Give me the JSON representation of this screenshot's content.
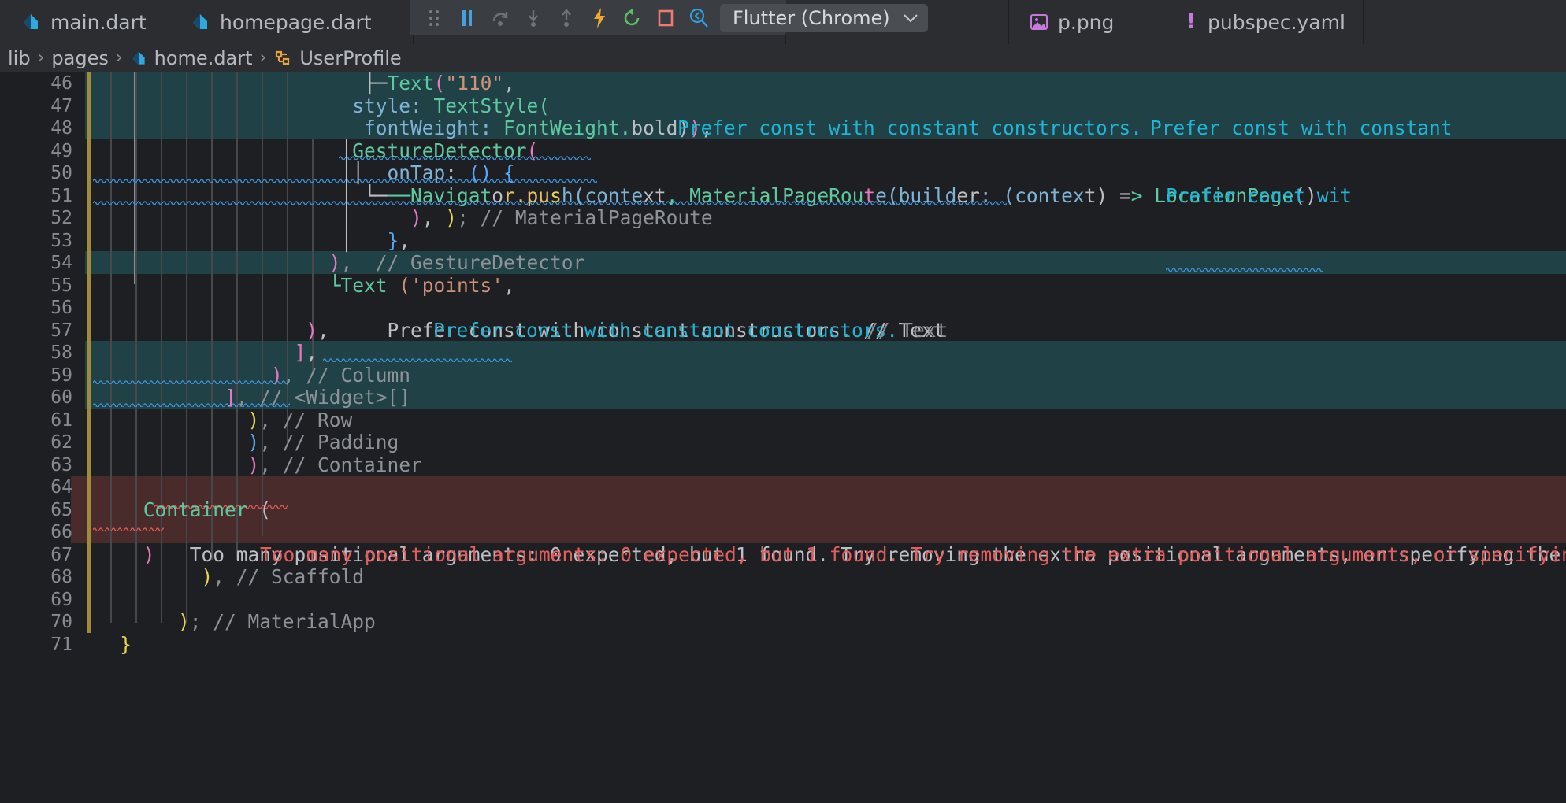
{
  "window": {
    "theme": "dark",
    "accent": "#3a8fd6",
    "background": "#1e1f22",
    "chrome_background": "#2b2d30"
  },
  "tabs": [
    {
      "label": "main.dart",
      "icon": "dart-file-icon",
      "active": false
    },
    {
      "label": "homepage.dart",
      "icon": "dart-file-icon",
      "active": false
    },
    {
      "label": "p.png",
      "icon": "image-file-icon",
      "active": false
    },
    {
      "label": "pubspec.yaml",
      "icon": "yaml-file-icon",
      "active": false
    }
  ],
  "debug_toolbar": {
    "drag_handle": "drag-handle-icon",
    "buttons": [
      {
        "name": "pause-button",
        "icon": "pause-icon",
        "color": "#4a9eda",
        "tooltip": "Pause Program"
      },
      {
        "name": "step-over-button",
        "icon": "step-over-icon",
        "color": "#6e7378",
        "tooltip": "Step Over"
      },
      {
        "name": "step-into-button",
        "icon": "step-into-icon",
        "color": "#6e7378",
        "tooltip": "Step Into"
      },
      {
        "name": "step-out-button",
        "icon": "step-out-icon",
        "color": "#6e7378",
        "tooltip": "Step Out"
      },
      {
        "name": "hot-reload-button",
        "icon": "lightning-icon",
        "color": "#f0a82e",
        "tooltip": "Hot Reload"
      },
      {
        "name": "hot-restart-button",
        "icon": "restart-icon",
        "color": "#5bbd6a",
        "tooltip": "Hot Restart"
      },
      {
        "name": "stop-button",
        "icon": "stop-square-icon",
        "color": "#f07a72",
        "tooltip": "Stop"
      },
      {
        "name": "widget-inspector-button",
        "icon": "magnifier-icon",
        "color": "#2f9fe0",
        "tooltip": "Open Flutter Inspector"
      }
    ],
    "device_selector": {
      "value": "Flutter (Chrome)",
      "chevron": "chevron-down-icon"
    }
  },
  "breadcrumb": {
    "separator": "›",
    "segments": [
      {
        "label": "lib",
        "icon": null
      },
      {
        "label": "pages",
        "icon": null
      },
      {
        "label": "home.dart",
        "icon": "dart-file-icon"
      },
      {
        "label": "UserProfile",
        "icon": "flutter-widget-icon"
      }
    ]
  },
  "editor": {
    "first_line": 46,
    "last_line": 71,
    "line_numbers": [
      46,
      47,
      48,
      49,
      50,
      51,
      52,
      53,
      54,
      55,
      56,
      57,
      58,
      59,
      60,
      61,
      62,
      63,
      64,
      65,
      66,
      67,
      68,
      69,
      70,
      71
    ],
    "lines": [
      {
        "n": 46,
        "text": "                        ├─Text(\"110\","
      },
      {
        "n": 47,
        "text": "                       style: TextStyle("
      },
      {
        "n": 48,
        "text": "                        fontWeight: FontWeight.bold)),"
      },
      {
        "n": 49,
        "text": "                      │GestureDetector("
      },
      {
        "n": 50,
        "text": "                      ││  onTap: () {"
      },
      {
        "n": 51,
        "text": "                      │ └───Navigator.push(context, MaterialPageRoute(builder: (context) => LocationPage()"
      },
      {
        "n": 52,
        "text": "                      │     ), ); // MaterialPageRoute"
      },
      {
        "n": 53,
        "text": "                      │   },"
      },
      {
        "n": 54,
        "text": "                     ),  // GestureDetector"
      },
      {
        "n": 55,
        "text": "                     └Text ('points',"
      },
      {
        "n": 56,
        "text": ""
      },
      {
        "n": 57,
        "text": "                   ),     Prefer const with constant constructors. // Text"
      },
      {
        "n": 58,
        "text": "                  ],"
      },
      {
        "n": 59,
        "text": "                ), // Column"
      },
      {
        "n": 60,
        "text": "            ], // <Widget>[]"
      },
      {
        "n": 61,
        "text": "              ), // Row"
      },
      {
        "n": 62,
        "text": "              ), // Padding"
      },
      {
        "n": 63,
        "text": "              ), // Container"
      },
      {
        "n": 64,
        "text": ""
      },
      {
        "n": 65,
        "text": "     Container ("
      },
      {
        "n": 66,
        "text": ""
      },
      {
        "n": 67,
        "text": "     )   Too many positional arguments: 0 expected, but 1 found. Try removing the extra positional arguments, or specifying the"
      },
      {
        "n": 68,
        "text": "          ), // Scaffold"
      },
      {
        "n": 69,
        "text": ""
      },
      {
        "n": 70,
        "text": "        ); // MaterialApp"
      },
      {
        "n": 71,
        "text": "   }"
      }
    ],
    "inline_hints": [
      {
        "line": 48,
        "text": "Prefer const with constant constructors.",
        "color": "#20b5d6"
      },
      {
        "line": 48,
        "text": "Prefer const with constant",
        "color": "#20b5d6"
      },
      {
        "line": 51,
        "text": "Prefer const wit",
        "color": "#20b5d6"
      },
      {
        "line": 57,
        "text": "Prefer const with constant constructors.",
        "color": "#20b5d6"
      }
    ],
    "errors": [
      {
        "line": 67,
        "text": "Too many positional arguments: 0 expected, but 1 found. Try removing the extra positional arguments, or specifying the",
        "color": "#e35d5d"
      }
    ],
    "highlighted_lines_teal": [
      46,
      47,
      48,
      51,
      55,
      56,
      57
    ],
    "highlighted_lines_red": [
      65,
      66,
      67
    ],
    "comments": {
      "l52": "// MaterialPageRoute",
      "l54": "// GestureDetector",
      "l57": "// Text",
      "l59": "// Column",
      "l60": "// <Widget>[]",
      "l61": "// Row",
      "l62": "// Padding",
      "l63": "// Container",
      "l68": "// Scaffold",
      "l70": "// MaterialApp"
    }
  }
}
